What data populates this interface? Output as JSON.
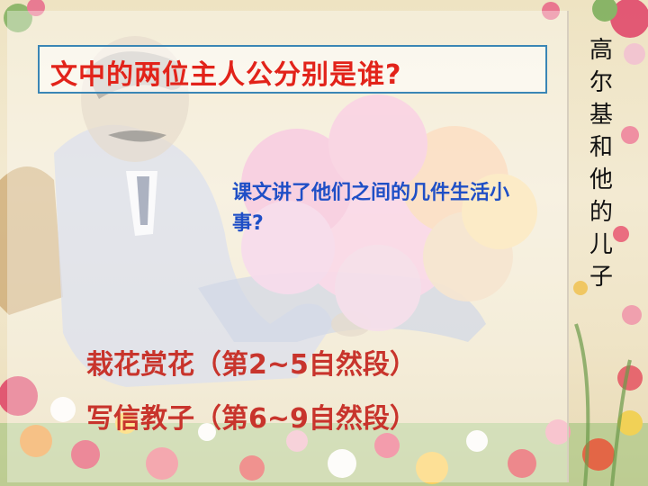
{
  "slide": {
    "question": "文中的两位主人公分别是谁?",
    "bubble_prompt": "课文讲了他们之间的几件生活小事?",
    "events": [
      "栽花赏花（第2~5自然段）",
      "写信教子（第6~9自然段）"
    ],
    "vertical_title": [
      "高",
      "尔",
      "基",
      "和",
      "他",
      "的",
      "儿",
      "子"
    ]
  },
  "colors": {
    "question_text": "#e2231a",
    "question_border": "#3a86b5",
    "bubble_text": "#1f4fc6",
    "event_text": "#c8342c",
    "bubble_fill": "#f7b9d6"
  }
}
